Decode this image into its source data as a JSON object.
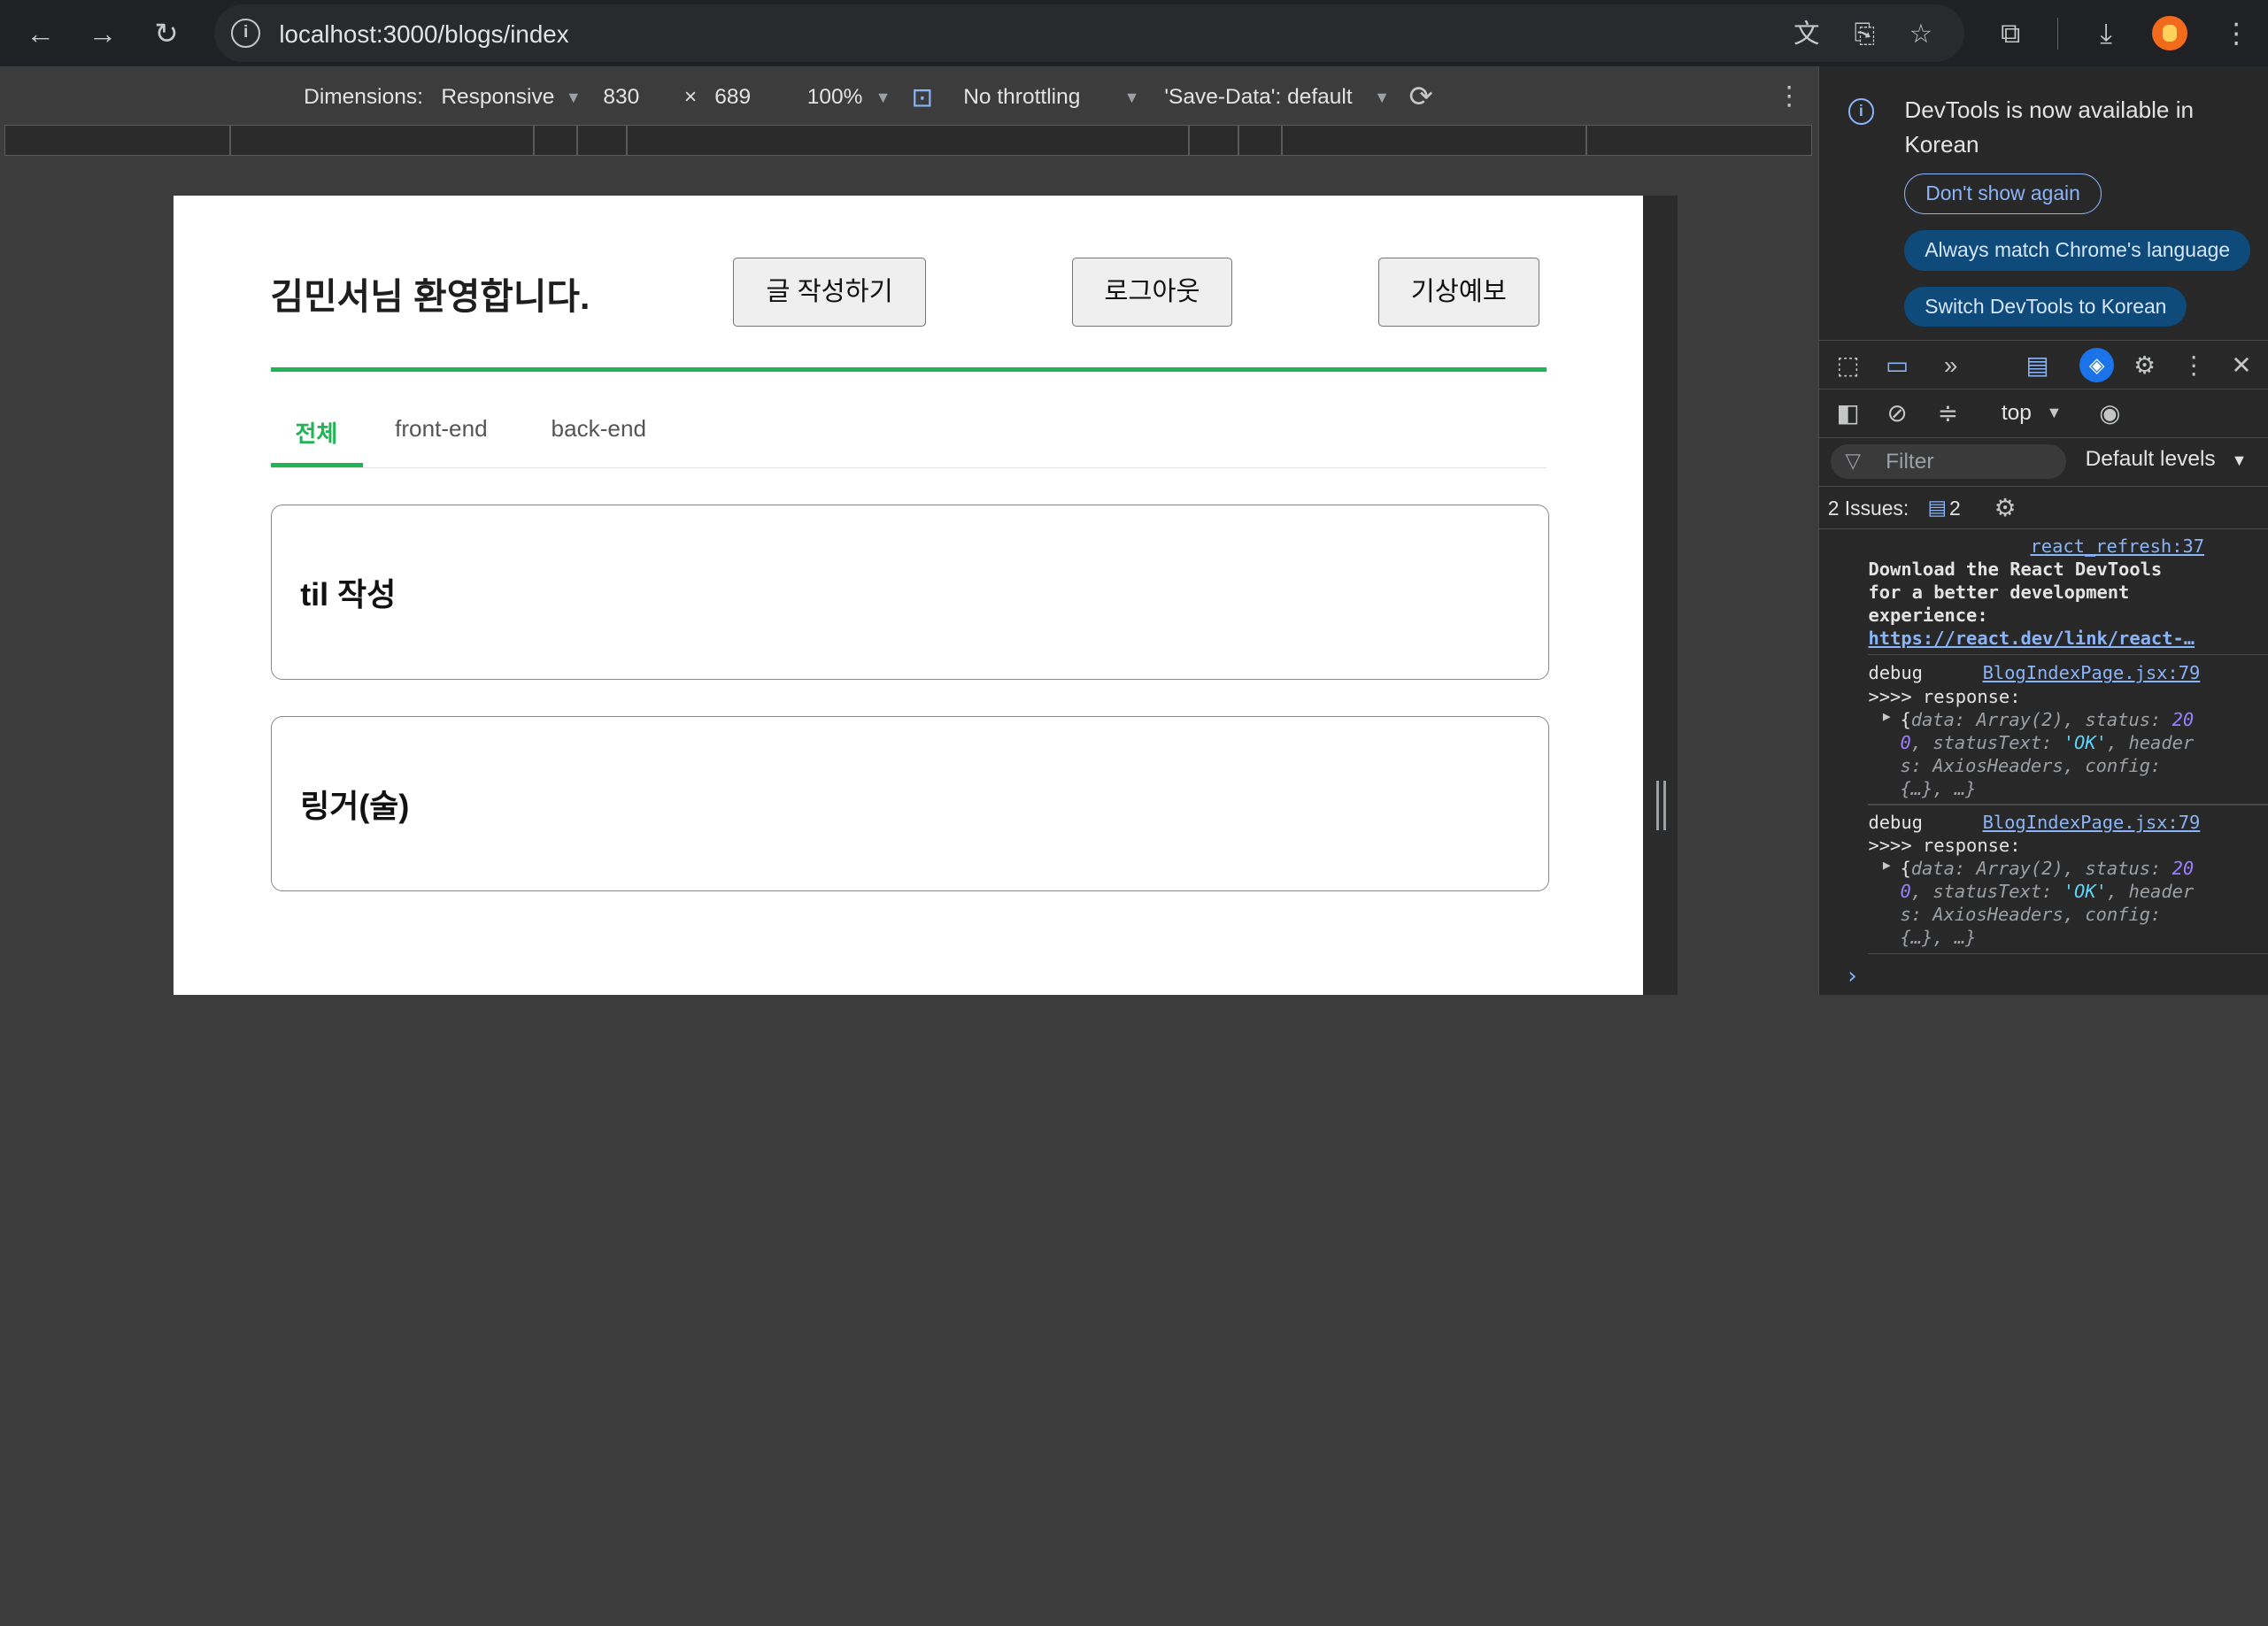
{
  "browser": {
    "url": "localhost:3000/blogs/index"
  },
  "device_toolbar": {
    "dimensions_label": "Dimensions:",
    "device": "Responsive",
    "width": "830",
    "times": "×",
    "height": "689",
    "zoom": "100%",
    "throttling": "No throttling",
    "save_data": "'Save-Data': default"
  },
  "page": {
    "welcome": "김민서님 환영합니다.",
    "buttons": {
      "write": "글 작성하기",
      "logout": "로그아웃",
      "weather": "기상예보"
    },
    "tabs": [
      "전체",
      "front-end",
      "back-end"
    ],
    "posts": [
      "til 작성",
      "링거(술)"
    ]
  },
  "devtools": {
    "notice": "DevTools is now available in Korean",
    "dont_show": "Don't show again",
    "always_match": "Always match Chrome's language",
    "switch_korean": "Switch DevTools to Korean",
    "context": "top",
    "filter_placeholder": "Filter",
    "levels": "Default levels",
    "issues_label": "2 Issues:",
    "issues_count": "2",
    "console": {
      "src1": "react_refresh:37",
      "react_msg_1": "Download the React DevTools",
      "react_msg_2": "for a better development",
      "react_msg_3": "experience:",
      "react_link": "https://react.dev/link/react-…",
      "debug_label": "debug",
      "debug_src": "BlogIndexPage.jsx:79",
      "response_label": ">>>> response:",
      "obj_l1a": "{",
      "obj_l1b": "data",
      "obj_l1c": ": Array(2), ",
      "obj_l1d": "status",
      "obj_l1e": ": ",
      "obj_l1f": "20",
      "obj_l2a": "0",
      "obj_l2b": ", ",
      "obj_l2c": "statusText",
      "obj_l2d": ": ",
      "obj_l2e": "'OK'",
      "obj_l2f": ", ",
      "obj_l2g": "header",
      "obj_l3a": "s",
      "obj_l3b": ": AxiosHeaders, ",
      "obj_l3c": "config",
      "obj_l3d": ":",
      "obj_l4": "{…}, …}"
    }
  },
  "colors": {
    "accent_green": "#21b455",
    "devtools_blue": "#8ab4f8"
  }
}
